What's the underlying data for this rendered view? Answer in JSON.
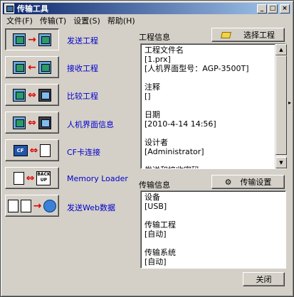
{
  "window": {
    "title": "传输工具"
  },
  "titlebar_buttons": [
    "_",
    "□",
    "×"
  ],
  "menu": [
    "文件(F)",
    "传输(T)",
    "设置(S)",
    "帮助(H)"
  ],
  "actions": [
    {
      "label": "发送工程",
      "icon": "send-project-icon"
    },
    {
      "label": "接收工程",
      "icon": "receive-project-icon"
    },
    {
      "label": "比较工程",
      "icon": "compare-project-icon"
    },
    {
      "label": "人机界面信息",
      "icon": "hmi-info-icon"
    },
    {
      "label": "CF卡连接",
      "icon": "cf-card-icon"
    },
    {
      "label": "Memory Loader",
      "icon": "memory-loader-icon"
    },
    {
      "label": "发送Web数据",
      "icon": "send-web-data-icon"
    }
  ],
  "glyphs": {
    "cf_card": "CF",
    "backup_top": "BACK",
    "backup_bottom": "UP"
  },
  "project_info": {
    "label": "工程信息",
    "select_button": "选择工程",
    "lines": [
      "工程文件名",
      "[1.prx]",
      "[人机界面型号：AGP-3500T]",
      "",
      "注释",
      "[]",
      "",
      "日期",
      "[2010-4-14 14:56]",
      "",
      "设计者",
      "[Administrator]",
      "",
      "发送和接收密码"
    ]
  },
  "transfer_info": {
    "label": "传输信息",
    "settings_button": "传输设置",
    "lines": [
      "设备",
      "[USB]",
      "",
      "传输工程",
      "[自动]",
      "",
      "传输系统",
      "[自动]"
    ]
  },
  "close_button": "关闭",
  "colors": {
    "link_text": "#0000cc",
    "titlebar": "#0a246a",
    "arrow": "#e00000"
  }
}
